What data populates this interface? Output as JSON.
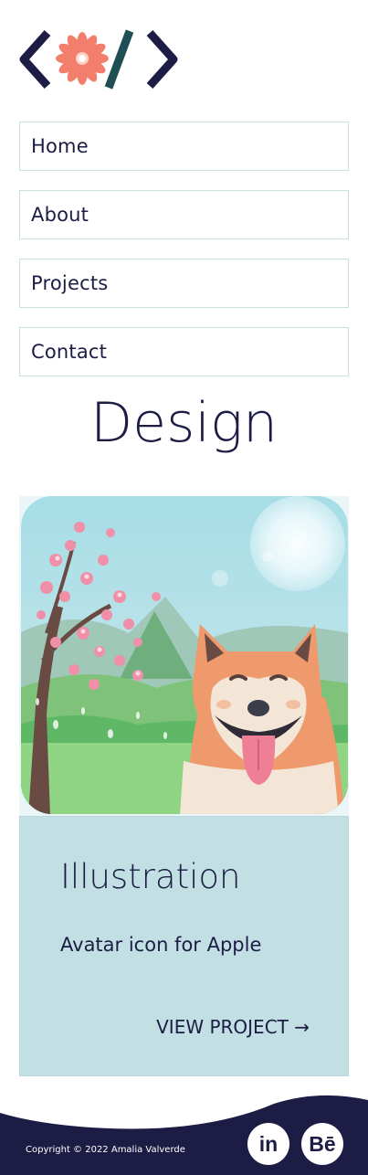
{
  "brand": {
    "logo": "code-flower-logo",
    "colors": {
      "navy": "#1c1c45",
      "teal": "#1f4f54",
      "coral": "#f27e6b"
    }
  },
  "nav": {
    "items": [
      {
        "label": "Home"
      },
      {
        "label": "About"
      },
      {
        "label": "Projects"
      },
      {
        "label": "Contact"
      }
    ]
  },
  "page": {
    "title": "Design"
  },
  "card": {
    "image": "shiba-inu-cherry-blossom-illustration",
    "title": "Illustration",
    "description": "Avatar icon for Apple",
    "link_label": "VIEW PROJECT →",
    "body_color": "#c2dfe3"
  },
  "footer": {
    "copyright": "Copyright © 2022 Amalia Valverde",
    "social": [
      {
        "icon": "linkedin-icon",
        "label": "in"
      },
      {
        "icon": "behance-icon",
        "label": "Bē"
      }
    ]
  }
}
